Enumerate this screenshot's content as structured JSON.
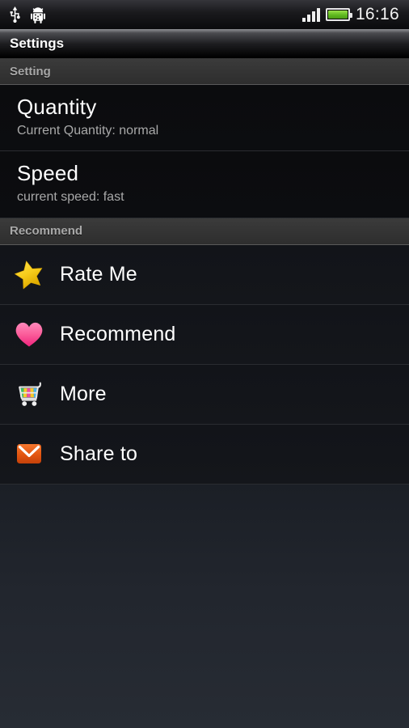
{
  "statusbar": {
    "time": "16:16",
    "icons": [
      "usb-icon",
      "android-debug-icon",
      "signal-icon",
      "battery-icon"
    ],
    "signal_bars": 4,
    "battery_color": "#6cba25"
  },
  "titlebar": {
    "title": "Settings"
  },
  "sections": [
    {
      "header": "Setting",
      "rows": [
        {
          "title": "Quantity",
          "summary": "Current Quantity: normal"
        },
        {
          "title": "Speed",
          "summary": "current speed: fast"
        }
      ]
    },
    {
      "header": "Recommend",
      "rows": [
        {
          "label": "Rate Me",
          "icon": "star-icon"
        },
        {
          "label": "Recommend",
          "icon": "heart-icon"
        },
        {
          "label": "More",
          "icon": "shopping-cart-icon"
        },
        {
          "label": "Share to",
          "icon": "envelope-icon"
        }
      ]
    }
  ],
  "colors": {
    "star": "#f5cc1e",
    "heart": "#f5458c",
    "envelope": "#e35510",
    "header_text": "#a8a8a8",
    "title_text": "#ffffff",
    "summary_text": "#a9a9a9"
  }
}
